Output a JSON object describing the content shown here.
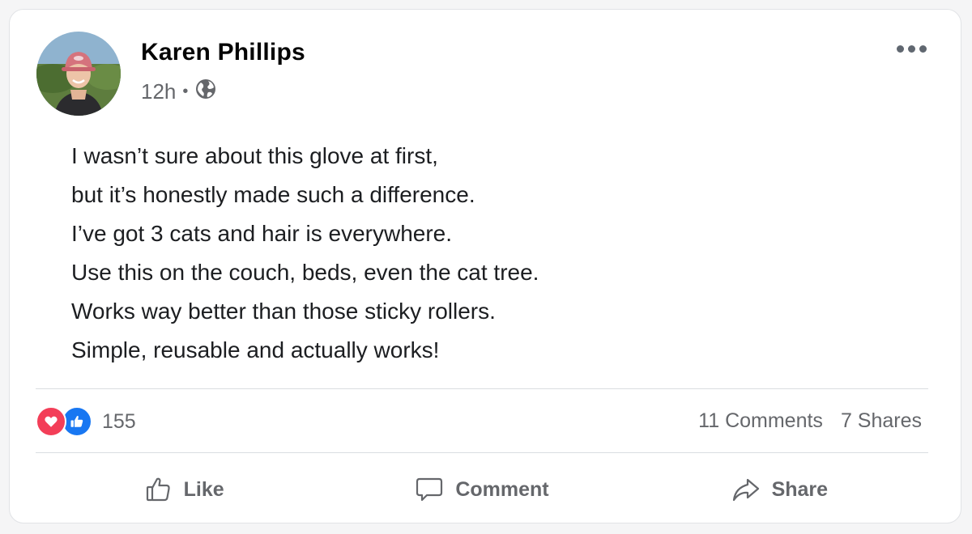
{
  "post": {
    "author": "Karen Phillips",
    "time": "12h",
    "separator": "•",
    "privacy_icon": "globe-icon",
    "lines": [
      "I wasn’t sure about this glove at first,",
      "but it’s honestly made such a difference.",
      "I’ve got 3 cats and hair is everywhere.",
      "Use this on the couch, beds, even the cat tree.",
      "Works way better than those sticky rollers.",
      "Simple, reusable and actually works!"
    ]
  },
  "reactions": {
    "count": "155",
    "icons": [
      "love-icon",
      "like-icon"
    ],
    "love_color": "#f33e58",
    "like_color": "#1877f2"
  },
  "stats": {
    "comments": "11 Comments",
    "shares": "7 Shares"
  },
  "actions": {
    "like": "Like",
    "comment": "Comment",
    "share": "Share"
  }
}
